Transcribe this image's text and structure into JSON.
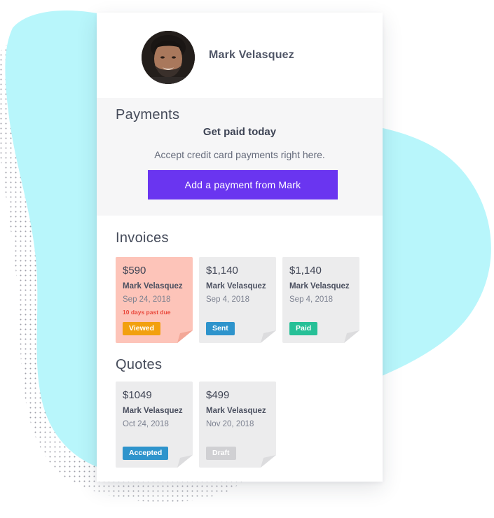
{
  "contact": {
    "name": "Mark Velasquez"
  },
  "payments": {
    "title": "Payments",
    "heading": "Get paid today",
    "subtitle": "Accept credit card payments right here.",
    "button_label": "Add a payment from Mark"
  },
  "invoices": {
    "title": "Invoices",
    "items": [
      {
        "amount": "$590",
        "client": "Mark Velasquez",
        "date": "Sep 24, 2018",
        "note": "10 days past due",
        "status": "Viewed",
        "status_color": "#f2a00f"
      },
      {
        "amount": "$1,140",
        "client": "Mark Velasquez",
        "date": "Sep 4, 2018",
        "status": "Sent",
        "status_color": "#2e94cc"
      },
      {
        "amount": "$1,140",
        "client": "Mark Velasquez",
        "date": "Sep 4, 2018",
        "status": "Paid",
        "status_color": "#26c097"
      }
    ]
  },
  "quotes": {
    "title": "Quotes",
    "items": [
      {
        "amount": "$1049",
        "client": "Mark Velasquez",
        "date": "Oct 24, 2018",
        "status": "Accepted",
        "status_color": "#2e94cc"
      },
      {
        "amount": "$499",
        "client": "Mark Velasquez",
        "date": "Nov 20, 2018",
        "status": "Draft",
        "status_color": "#d0d0d3"
      }
    ]
  },
  "colors": {
    "accent": "#6a35f0",
    "blob": "#b8f6fb",
    "overdue_card": "#fdc4b9",
    "overdue_text": "#e9473b"
  }
}
